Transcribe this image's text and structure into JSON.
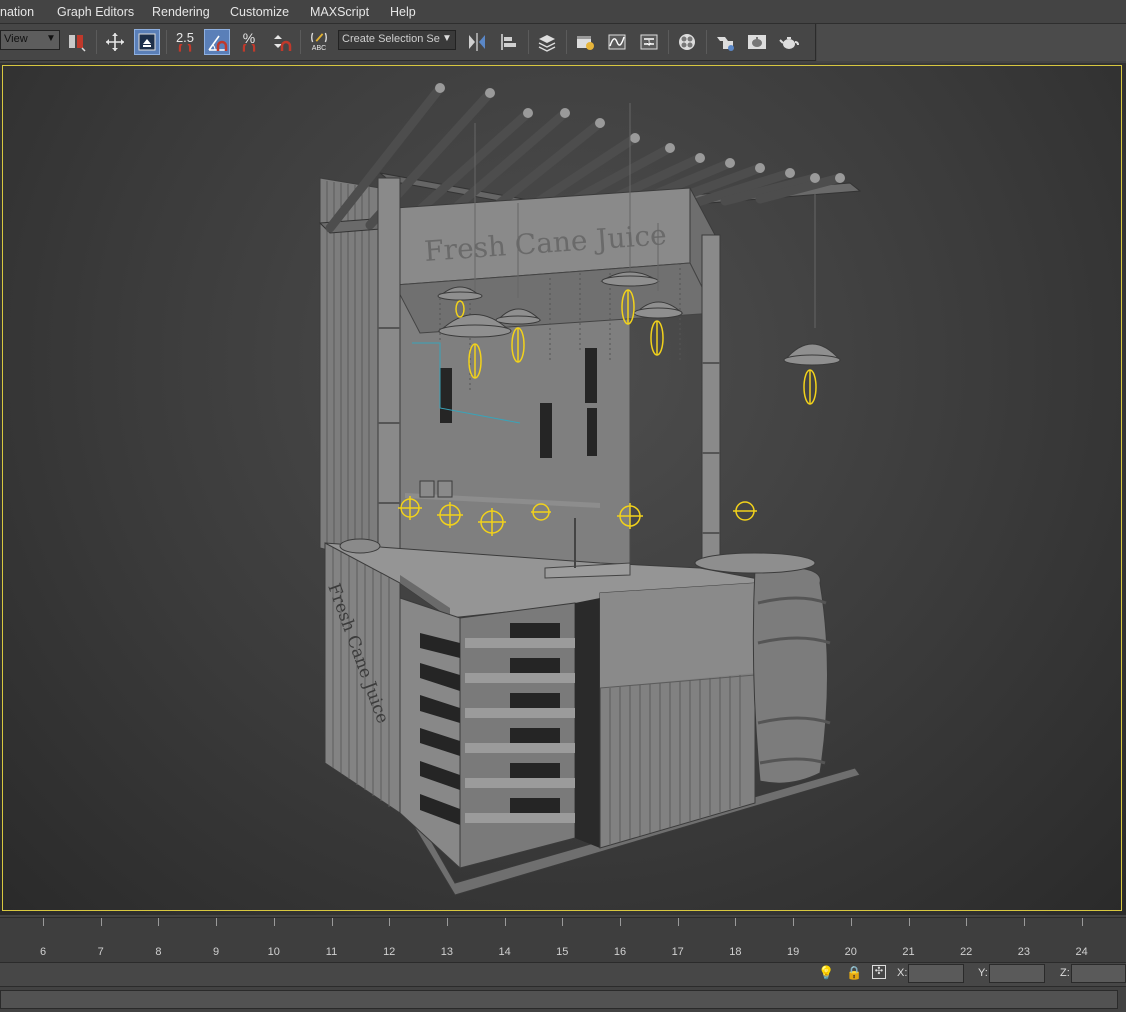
{
  "menu": {
    "items": [
      "nation",
      "Graph Editors",
      "Rendering",
      "Customize",
      "MAXScript",
      "Help"
    ]
  },
  "toolbar": {
    "view_dropdown": "View",
    "snap_2_5": "2.5",
    "percent_snap": "%",
    "selection_set": "Create Selection Se",
    "named_sel_abc": "ABC"
  },
  "timeline": {
    "ticks": [
      "6",
      "7",
      "8",
      "9",
      "10",
      "11",
      "12",
      "13",
      "14",
      "15",
      "16",
      "17",
      "18",
      "19",
      "20",
      "21",
      "22",
      "23",
      "24"
    ]
  },
  "status": {
    "x_label": "X:",
    "y_label": "Y:",
    "z_label": "Z:"
  },
  "scene": {
    "sign_text": "Fresh Cane Juice",
    "side_sign_text": "Fresh Cane Juice"
  },
  "colors": {
    "selection_border": "#d8c840",
    "light_helper": "#f2d21b",
    "active_button": "#5a7fb8"
  }
}
